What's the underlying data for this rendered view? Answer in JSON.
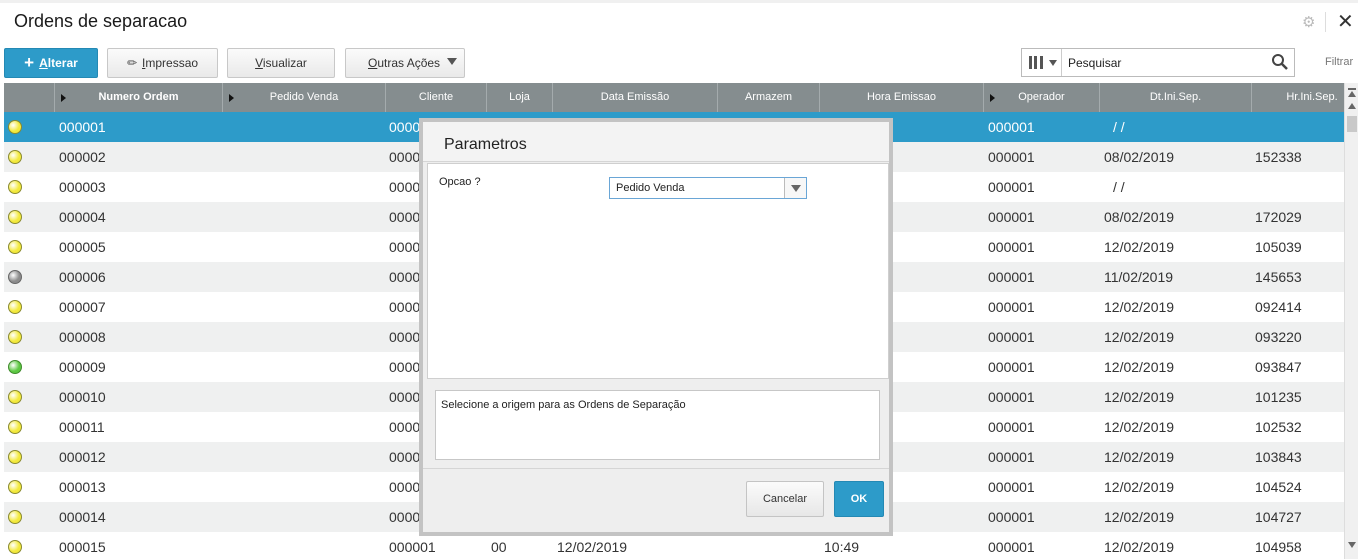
{
  "window": {
    "title": "Ordens de separacao",
    "settings_icon": "gear-icon",
    "close_icon": "close-icon"
  },
  "toolbar": {
    "alterar": {
      "prefix": "+",
      "hotkey": "A",
      "rest": "lterar"
    },
    "impressao": {
      "hotkey": "I",
      "rest": "mpressao"
    },
    "visualizar": {
      "hotkey": "V",
      "rest": "isualizar"
    },
    "outras": {
      "hotkey": "O",
      "rest": "utras Ações"
    }
  },
  "search": {
    "value": "Pesquisar",
    "filter_label": "Filtrar"
  },
  "colors": {
    "accent": "#2d9bc9",
    "header": "#858d8f",
    "status_yellow": "#f2e93b",
    "status_gray": "#8c8c8c",
    "status_green": "#5dc842"
  },
  "table": {
    "columns": [
      "Numero Ordem",
      "Pedido Venda",
      "Cliente",
      "Loja",
      "Data Emissão",
      "Armazem",
      "Hora Emissao",
      "Operador",
      "Dt.Ini.Sep.",
      "Hr.Ini.Sep."
    ],
    "rows": [
      {
        "status": "yellow",
        "numero": "000001",
        "cliente": "0000",
        "operador": "000001",
        "dtini": "/  /",
        "hrini": ""
      },
      {
        "status": "yellow",
        "numero": "000002",
        "cliente": "0000",
        "operador": "000001",
        "dtini": "08/02/2019",
        "hrini": "152338"
      },
      {
        "status": "yellow",
        "numero": "000003",
        "cliente": "0000",
        "operador": "000001",
        "dtini": "/  /",
        "hrini": ""
      },
      {
        "status": "yellow",
        "numero": "000004",
        "cliente": "0000",
        "operador": "000001",
        "dtini": "08/02/2019",
        "hrini": "172029"
      },
      {
        "status": "yellow",
        "numero": "000005",
        "cliente": "0000",
        "operador": "000001",
        "dtini": "12/02/2019",
        "hrini": "105039"
      },
      {
        "status": "gray",
        "numero": "000006",
        "cliente": "0000",
        "operador": "000001",
        "dtini": "11/02/2019",
        "hrini": "145653"
      },
      {
        "status": "yellow",
        "numero": "000007",
        "cliente": "0000",
        "operador": "000001",
        "dtini": "12/02/2019",
        "hrini": "092414"
      },
      {
        "status": "yellow",
        "numero": "000008",
        "cliente": "0000",
        "operador": "000001",
        "dtini": "12/02/2019",
        "hrini": "093220"
      },
      {
        "status": "green",
        "numero": "000009",
        "cliente": "0000",
        "operador": "000001",
        "dtini": "12/02/2019",
        "hrini": "093847"
      },
      {
        "status": "yellow",
        "numero": "000010",
        "cliente": "0000",
        "operador": "000001",
        "dtini": "12/02/2019",
        "hrini": "101235"
      },
      {
        "status": "yellow",
        "numero": "000011",
        "cliente": "0000",
        "operador": "000001",
        "dtini": "12/02/2019",
        "hrini": "102532"
      },
      {
        "status": "yellow",
        "numero": "000012",
        "cliente": "0000",
        "operador": "000001",
        "dtini": "12/02/2019",
        "hrini": "103843"
      },
      {
        "status": "yellow",
        "numero": "000013",
        "cliente": "0000",
        "operador": "000001",
        "dtini": "12/02/2019",
        "hrini": "104524"
      },
      {
        "status": "yellow",
        "numero": "000014",
        "cliente": "0000",
        "operador": "000001",
        "dtini": "12/02/2019",
        "hrini": "104727"
      },
      {
        "status": "yellow",
        "numero": "000015",
        "cliente": "000001",
        "loja": "00",
        "emissao": "12/02/2019",
        "hora": "10:49",
        "operador": "000001",
        "dtini": "12/02/2019",
        "hrini": "104958"
      }
    ]
  },
  "dialog": {
    "title": "Parametros",
    "opcao_label": "Opcao ?",
    "opcao_value": "Pedido Venda",
    "help_text": "Selecione a origem para as Ordens de Separação",
    "cancel_label": "Cancelar",
    "ok_label": "OK"
  }
}
